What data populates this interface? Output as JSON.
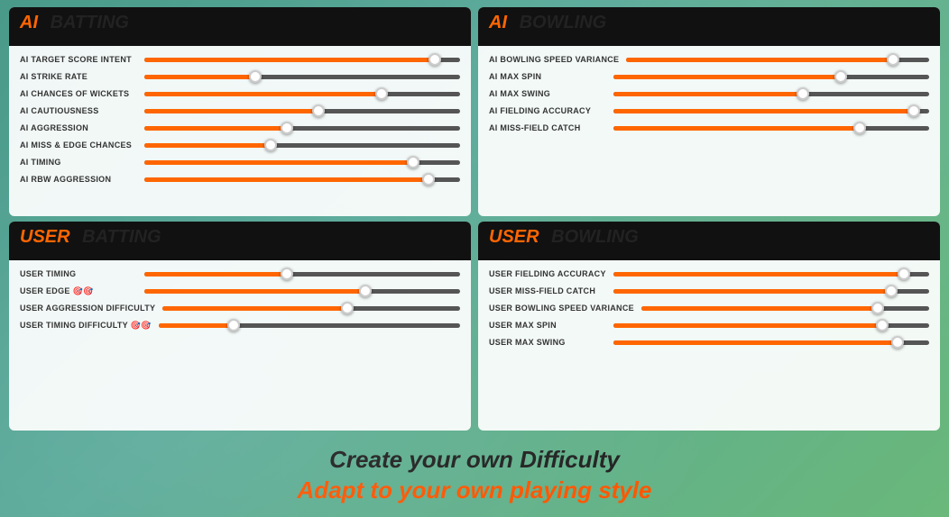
{
  "background": {
    "color1": "#4a9a8a",
    "color2": "#6ab87a"
  },
  "panels": {
    "ai_batting": {
      "title_prefix": "AI",
      "title_suffix": "BATTING",
      "sliders": [
        {
          "label": "AI TARGET SCORE INTENT",
          "fill_pct": 92,
          "thumb_pct": 92
        },
        {
          "label": "AI STRIKE RATE",
          "fill_pct": 35,
          "thumb_pct": 35
        },
        {
          "label": "AI CHANCES OF WICKETS",
          "fill_pct": 75,
          "thumb_pct": 75
        },
        {
          "label": "AI CAUTIOUSNESS",
          "fill_pct": 55,
          "thumb_pct": 55
        },
        {
          "label": "AI AGGRESSION",
          "fill_pct": 45,
          "thumb_pct": 45
        },
        {
          "label": "AI MISS & EDGE CHANCES",
          "fill_pct": 40,
          "thumb_pct": 40
        },
        {
          "label": "AI TIMING",
          "fill_pct": 85,
          "thumb_pct": 85
        },
        {
          "label": "AI RBW AGGRESSION",
          "fill_pct": 90,
          "thumb_pct": 90
        }
      ]
    },
    "ai_bowling": {
      "title_prefix": "AI",
      "title_suffix": "BOWLING",
      "sliders": [
        {
          "label": "AI BOWLING SPEED VARIANCE",
          "fill_pct": 88,
          "thumb_pct": 88
        },
        {
          "label": "AI MAX SPIN",
          "fill_pct": 72,
          "thumb_pct": 72
        },
        {
          "label": "AI MAX SWING",
          "fill_pct": 60,
          "thumb_pct": 60
        },
        {
          "label": "AI FIELDING ACCURACY",
          "fill_pct": 95,
          "thumb_pct": 95
        },
        {
          "label": "AI MISS-FIELD CATCH",
          "fill_pct": 78,
          "thumb_pct": 78
        }
      ]
    },
    "user_batting": {
      "title_prefix": "USER",
      "title_suffix": "BATTING",
      "sliders": [
        {
          "label": "USER TIMING",
          "fill_pct": 45,
          "thumb_pct": 45
        },
        {
          "label": "USER EDGE 🎯🎯",
          "fill_pct": 70,
          "thumb_pct": 70
        },
        {
          "label": "USER AGGRESSION DIFFICULTY",
          "fill_pct": 62,
          "thumb_pct": 62
        },
        {
          "label": "USER TIMING DIFFICULTY 🎯🎯",
          "fill_pct": 25,
          "thumb_pct": 25
        }
      ]
    },
    "user_bowling": {
      "title_prefix": "USER",
      "title_suffix": "BOWLING",
      "sliders": [
        {
          "label": "USER FIELDING ACCURACY",
          "fill_pct": 92,
          "thumb_pct": 92
        },
        {
          "label": "USER MISS-FIELD CATCH",
          "fill_pct": 88,
          "thumb_pct": 88
        },
        {
          "label": "USER BOWLING SPEED VARIANCE",
          "fill_pct": 82,
          "thumb_pct": 82
        },
        {
          "label": "USER MAX SPIN",
          "fill_pct": 85,
          "thumb_pct": 85
        },
        {
          "label": "USER MAX SWING",
          "fill_pct": 90,
          "thumb_pct": 90
        }
      ]
    }
  },
  "bottom": {
    "line1": "Create your own Difficulty",
    "line2": "Adapt to your own playing style"
  }
}
